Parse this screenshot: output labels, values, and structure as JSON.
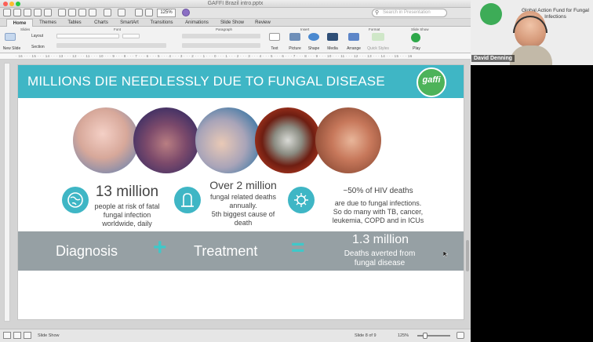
{
  "window": {
    "doc_title": "GAFFI Brazil intro.pptx"
  },
  "toolbar": {
    "zoom": "125%",
    "search_placeholder": "Search in Presentation"
  },
  "tabs": [
    "Home",
    "Themes",
    "Tables",
    "Charts",
    "SmartArt",
    "Transitions",
    "Animations",
    "Slide Show",
    "Review"
  ],
  "ribbon": {
    "groups": [
      "Slides",
      "Font",
      "Paragraph",
      "Insert",
      "Format",
      "Slide Show"
    ],
    "new_slide": "New Slide",
    "layout": "Layout",
    "section": "Section",
    "insert_items": [
      "Text",
      "Picture",
      "Shape",
      "Media"
    ],
    "format_items": [
      "Arrange",
      "Quick Styles"
    ],
    "play": "Play"
  },
  "ruler": "· 16 · · · 15 · · · 14 · · · 13 · · · 12 · · · 11 · · · 10 · · · 9 · · · 8 · · · 7 · · · 6 · · · 5 · · · 4 · · · 3 · · · 2 · · · 1 · · · 0 · · · 1 · · · 2 · · · 3 · · · 4 · · · 5 · · · 6 · · · 7 · · · 8 · · · 9 · · · 10 · · · 11 · · · 12 · · · 13 · · · 14 · · · 15 · · · 16",
  "slide": {
    "title": "MILLIONS DIE NEEDLESSLY DUE TO FUNGAL DISEASE",
    "logo": "gaffi",
    "stat1": {
      "big": "13 million",
      "lines": [
        "people at risk of fatal",
        "fungal infection",
        "worldwide, daily"
      ]
    },
    "stat2": {
      "big": "Over 2 million",
      "lines": [
        "fungal related deaths",
        "annually.",
        "5th biggest cause  of",
        "death"
      ]
    },
    "stat3": {
      "big": "~50% of HIV deaths",
      "lines": [
        "are due to fungal  infections.",
        "So do many  with TB, cancer,",
        "leukemia, COPD and in ICUs"
      ]
    },
    "band": {
      "diagnosis": "Diagnosis",
      "plus": "+",
      "treatment": "Treatment",
      "equals": "=",
      "big": "1.3 million",
      "line1": "Deaths averted from",
      "line2": "fungal disease"
    }
  },
  "status": {
    "view": "Slide Show",
    "slide_of": "Slide 8 of 9",
    "zoom": "125%"
  },
  "video": {
    "name": "David Denning",
    "backdrop_text": "Global Action Fund for Fungal Infections"
  }
}
